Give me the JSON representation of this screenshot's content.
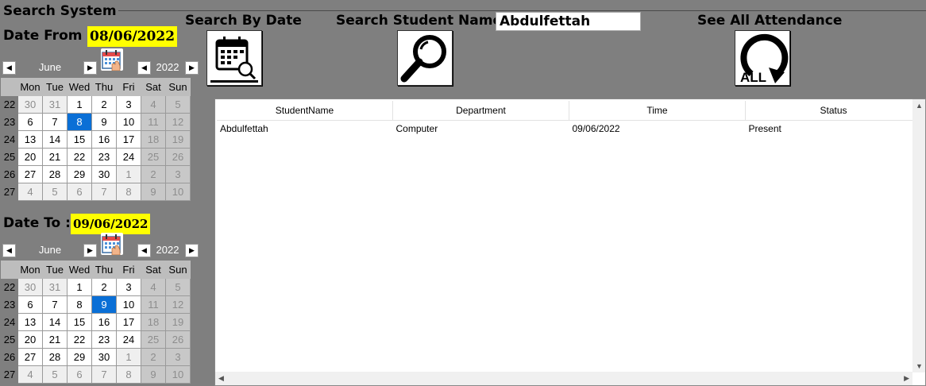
{
  "group": {
    "title": "Search System"
  },
  "date_from": {
    "label": "Date From :",
    "value": "08/06/2022"
  },
  "date_to": {
    "label": "Date To :",
    "value": "09/06/2022"
  },
  "cal_from": {
    "month": "June",
    "year": "2022",
    "dow": [
      "Mon",
      "Tue",
      "Wed",
      "Thu",
      "Fri",
      "Sat",
      "Sun"
    ],
    "weeks": [
      "22",
      "23",
      "24",
      "25",
      "26",
      "27"
    ],
    "days": [
      [
        "30",
        "31",
        "1",
        "2",
        "3",
        "4",
        "5"
      ],
      [
        "6",
        "7",
        "8",
        "9",
        "10",
        "11",
        "12"
      ],
      [
        "13",
        "14",
        "15",
        "16",
        "17",
        "18",
        "19"
      ],
      [
        "20",
        "21",
        "22",
        "23",
        "24",
        "25",
        "26"
      ],
      [
        "27",
        "28",
        "29",
        "30",
        "1",
        "2",
        "3"
      ],
      [
        "4",
        "5",
        "6",
        "7",
        "8",
        "9",
        "10"
      ]
    ],
    "selected": "8"
  },
  "cal_to": {
    "month": "June",
    "year": "2022",
    "dow": [
      "Mon",
      "Tue",
      "Wed",
      "Thu",
      "Fri",
      "Sat",
      "Sun"
    ],
    "weeks": [
      "22",
      "23",
      "24",
      "25",
      "26",
      "27"
    ],
    "days": [
      [
        "30",
        "31",
        "1",
        "2",
        "3",
        "4",
        "5"
      ],
      [
        "6",
        "7",
        "8",
        "9",
        "10",
        "11",
        "12"
      ],
      [
        "13",
        "14",
        "15",
        "16",
        "17",
        "18",
        "19"
      ],
      [
        "20",
        "21",
        "22",
        "23",
        "24",
        "25",
        "26"
      ],
      [
        "27",
        "28",
        "29",
        "30",
        "1",
        "2",
        "3"
      ],
      [
        "4",
        "5",
        "6",
        "7",
        "8",
        "9",
        "10"
      ]
    ],
    "selected": "9"
  },
  "search_by_date": {
    "label": "Search By Date",
    "icon": "calendar-search-icon"
  },
  "search_name": {
    "label": "Search Student Name:",
    "value": "Abdulfettah",
    "icon": "magnifier-icon"
  },
  "see_all": {
    "label": "See All Attendance",
    "icon": "refresh-all-icon",
    "icon_text": "ALL"
  },
  "grid": {
    "columns": [
      "StudentName",
      "Department",
      "Time",
      "Status"
    ],
    "rows": [
      [
        "Abdulfettah",
        "Computer",
        "09/06/2022",
        "Present"
      ]
    ]
  }
}
